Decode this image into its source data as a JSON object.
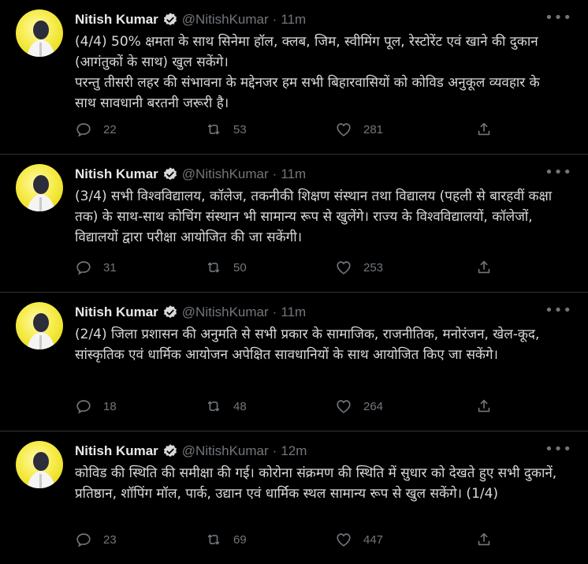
{
  "tweets": [
    {
      "name": "Nitish Kumar",
      "handle": "@NitishKumar",
      "dot": "·",
      "time": "11m",
      "text": [
        "(4/4) 50% क्षमता के साथ सिनेमा हॉल, क्लब, जिम, स्वीमिंग पूल, रेस्टोरेंट एवं खाने की दुकान (आगंतुकों के साथ) खुल सकेंगे।",
        "परन्तु तीसरी लहर की संभावना के मद्देनजर हम सभी बिहारवासियों को कोविड अनुकूल व्यवहार के साथ सावधानी बरतनी जरूरी है।"
      ],
      "replies": "22",
      "retweets": "53",
      "likes": "281"
    },
    {
      "name": "Nitish Kumar",
      "handle": "@NitishKumar",
      "dot": "·",
      "time": "11m",
      "text": [
        "(3/4) सभी विश्वविद्यालय, कॉलेज, तकनीकी शिक्षण संस्थान तथा विद्यालय (पहली से बारहवीं कक्षा तक) के साथ-साथ कोचिंग संस्थान भी सामान्य रूप से खुलेंगे। राज्य के विश्वविद्यालयों, कॉलेजों, विद्यालयों द्वारा परीक्षा आयोजित की जा सकेंगी।"
      ],
      "replies": "31",
      "retweets": "50",
      "likes": "253"
    },
    {
      "name": "Nitish Kumar",
      "handle": "@NitishKumar",
      "dot": "·",
      "time": "11m",
      "text": [
        "(2/4) जिला प्रशासन की अनुमति से सभी प्रकार के सामाजिक, राजनीतिक, मनोरंजन, खेल-कूद, सांस्कृतिक एवं धार्मिक आयोजन अपेक्षित सावधानियों के साथ आयोजित किए जा सकेंगे।"
      ],
      "replies": "18",
      "retweets": "48",
      "likes": "264"
    },
    {
      "name": "Nitish Kumar",
      "handle": "@NitishKumar",
      "dot": "·",
      "time": "12m",
      "text": [
        "कोविड की स्थिति की समीक्षा की गई। कोरोना संक्रमण की स्थिति में सुधार को देखते हुए सभी दुकानें, प्रतिष्ठान, शॉपिंग मॉल, पार्क, उद्यान एवं धार्मिक स्थल सामान्य रूप से खुल सकेंगे। (1/4)"
      ],
      "replies": "23",
      "retweets": "69",
      "likes": "447"
    }
  ],
  "more_glyph": "•••",
  "colors": {
    "background": "#000000",
    "text": "#d9d9d9",
    "secondary": "#71767b",
    "divider": "#2f3336",
    "avatar_yellow": "#f6ec4a"
  },
  "icons": [
    "reply-icon",
    "retweet-icon",
    "like-icon",
    "share-icon",
    "verified-badge-icon",
    "more-icon"
  ]
}
